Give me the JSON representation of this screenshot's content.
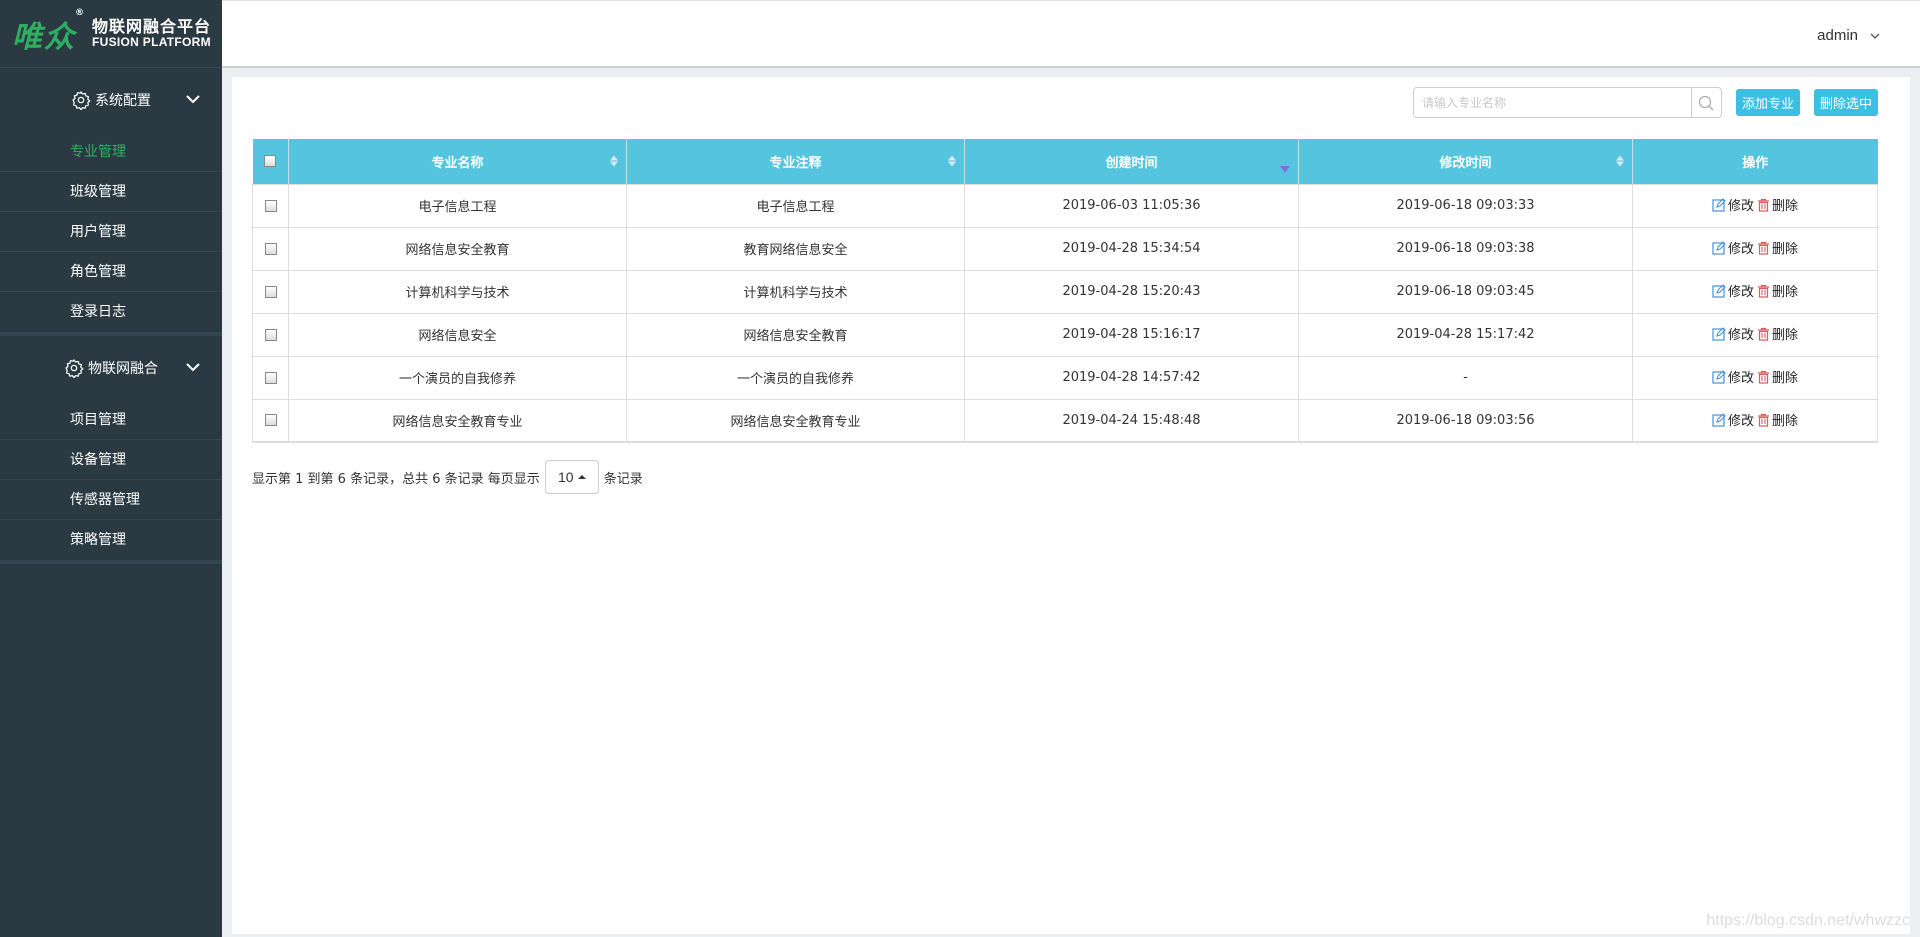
{
  "brand": {
    "logo_mark": "唯众",
    "registered": "®",
    "title_cn": "物联网融合平台",
    "title_en": "FUSION PLATFORM",
    "accent_color": "#2fae62"
  },
  "sidebar": {
    "groups": [
      {
        "label": "系统配置",
        "icon": "gear-icon",
        "items": [
          {
            "label": "专业管理",
            "active": true
          },
          {
            "label": "班级管理"
          },
          {
            "label": "用户管理"
          },
          {
            "label": "角色管理"
          },
          {
            "label": "登录日志"
          }
        ]
      },
      {
        "label": "物联网融合",
        "icon": "gear-icon",
        "items": [
          {
            "label": "项目管理"
          },
          {
            "label": "设备管理"
          },
          {
            "label": "传感器管理"
          },
          {
            "label": "策略管理"
          }
        ]
      }
    ]
  },
  "header": {
    "username": "admin"
  },
  "toolbar": {
    "search_placeholder": "请输入专业名称",
    "search_value": "",
    "add_label": "添加专业",
    "delete_selected_label": "删除选中"
  },
  "table": {
    "columns": [
      "专业名称",
      "专业注释",
      "创建时间",
      "修改时间",
      "操作"
    ],
    "sorted_column": "创建时间",
    "sort_direction": "desc",
    "rows": [
      {
        "name": "电子信息工程",
        "note": "电子信息工程",
        "created": "2019-06-03 11:05:36",
        "modified": "2019-06-18 09:03:33"
      },
      {
        "name": "网络信息安全教育",
        "note": "教育网络信息安全",
        "created": "2019-04-28 15:34:54",
        "modified": "2019-06-18 09:03:38"
      },
      {
        "name": "计算机科学与技术",
        "note": "计算机科学与技术",
        "created": "2019-04-28 15:20:43",
        "modified": "2019-06-18 09:03:45"
      },
      {
        "name": "网络信息安全",
        "note": "网络信息安全教育",
        "created": "2019-04-28 15:16:17",
        "modified": "2019-04-28 15:17:42"
      },
      {
        "name": "一个演员的自我修养",
        "note": "一个演员的自我修养",
        "created": "2019-04-28 14:57:42",
        "modified": "-"
      },
      {
        "name": "网络信息安全教育专业",
        "note": "网络信息安全教育专业",
        "created": "2019-04-24 15:48:48",
        "modified": "2019-06-18 09:03:56"
      }
    ],
    "edit_label": "修改",
    "delete_label": "删除"
  },
  "pagination": {
    "summary": "显示第 1 到第 6 条记录，总共 6 条记录 每页显示",
    "page_size": "10",
    "suffix": "条记录"
  },
  "watermark": "https://blog.csdn.net/whwzzc",
  "colors": {
    "sidebar_bg": "#2b3a42",
    "table_header": "#55c4de",
    "button": "#3dbfe3",
    "sort_active": "#7b6fe0",
    "edit_icon": "#4a90d9",
    "delete_icon": "#e05a5a"
  }
}
